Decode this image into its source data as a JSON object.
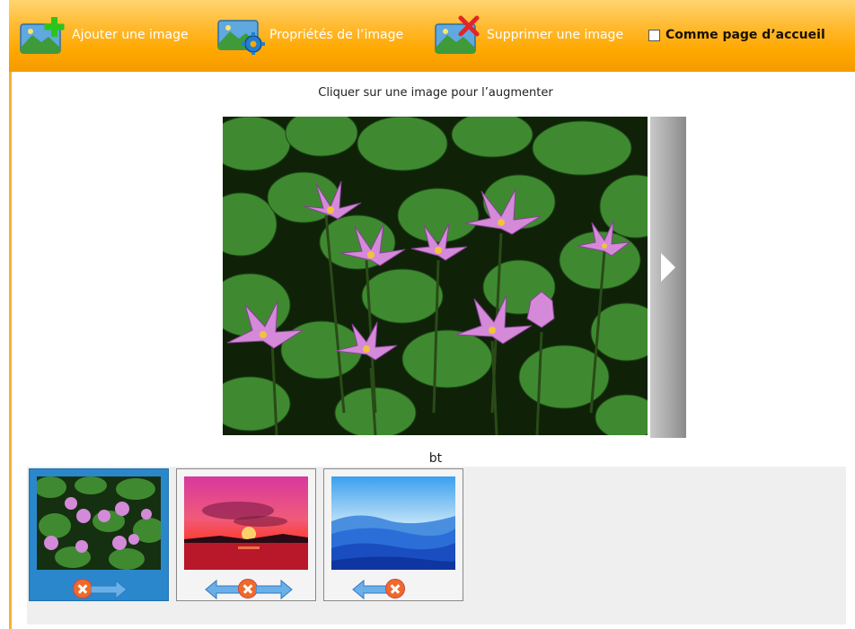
{
  "toolbar": {
    "add_label": "Ajouter une image",
    "props_label": "Propriétés de l’image",
    "delete_label": "Supprimer une image",
    "home_label": "Comme page d’accueil",
    "home_checked": false
  },
  "viewer": {
    "instruction": "Cliquer sur une image pour l’augmenter",
    "caption": "bt"
  },
  "thumbnails": [
    {
      "id": "water-lilies",
      "selected": true,
      "controls": [
        "delete",
        "move-right"
      ]
    },
    {
      "id": "sunset",
      "selected": false,
      "controls": [
        "move-left",
        "delete",
        "move-right"
      ]
    },
    {
      "id": "blue-hills",
      "selected": false,
      "controls": [
        "move-left",
        "delete"
      ]
    }
  ],
  "colors": {
    "toolbar": "#ffa800",
    "selected_thumb": "#2b87cc",
    "delete_badge": "#ef6a2a"
  }
}
